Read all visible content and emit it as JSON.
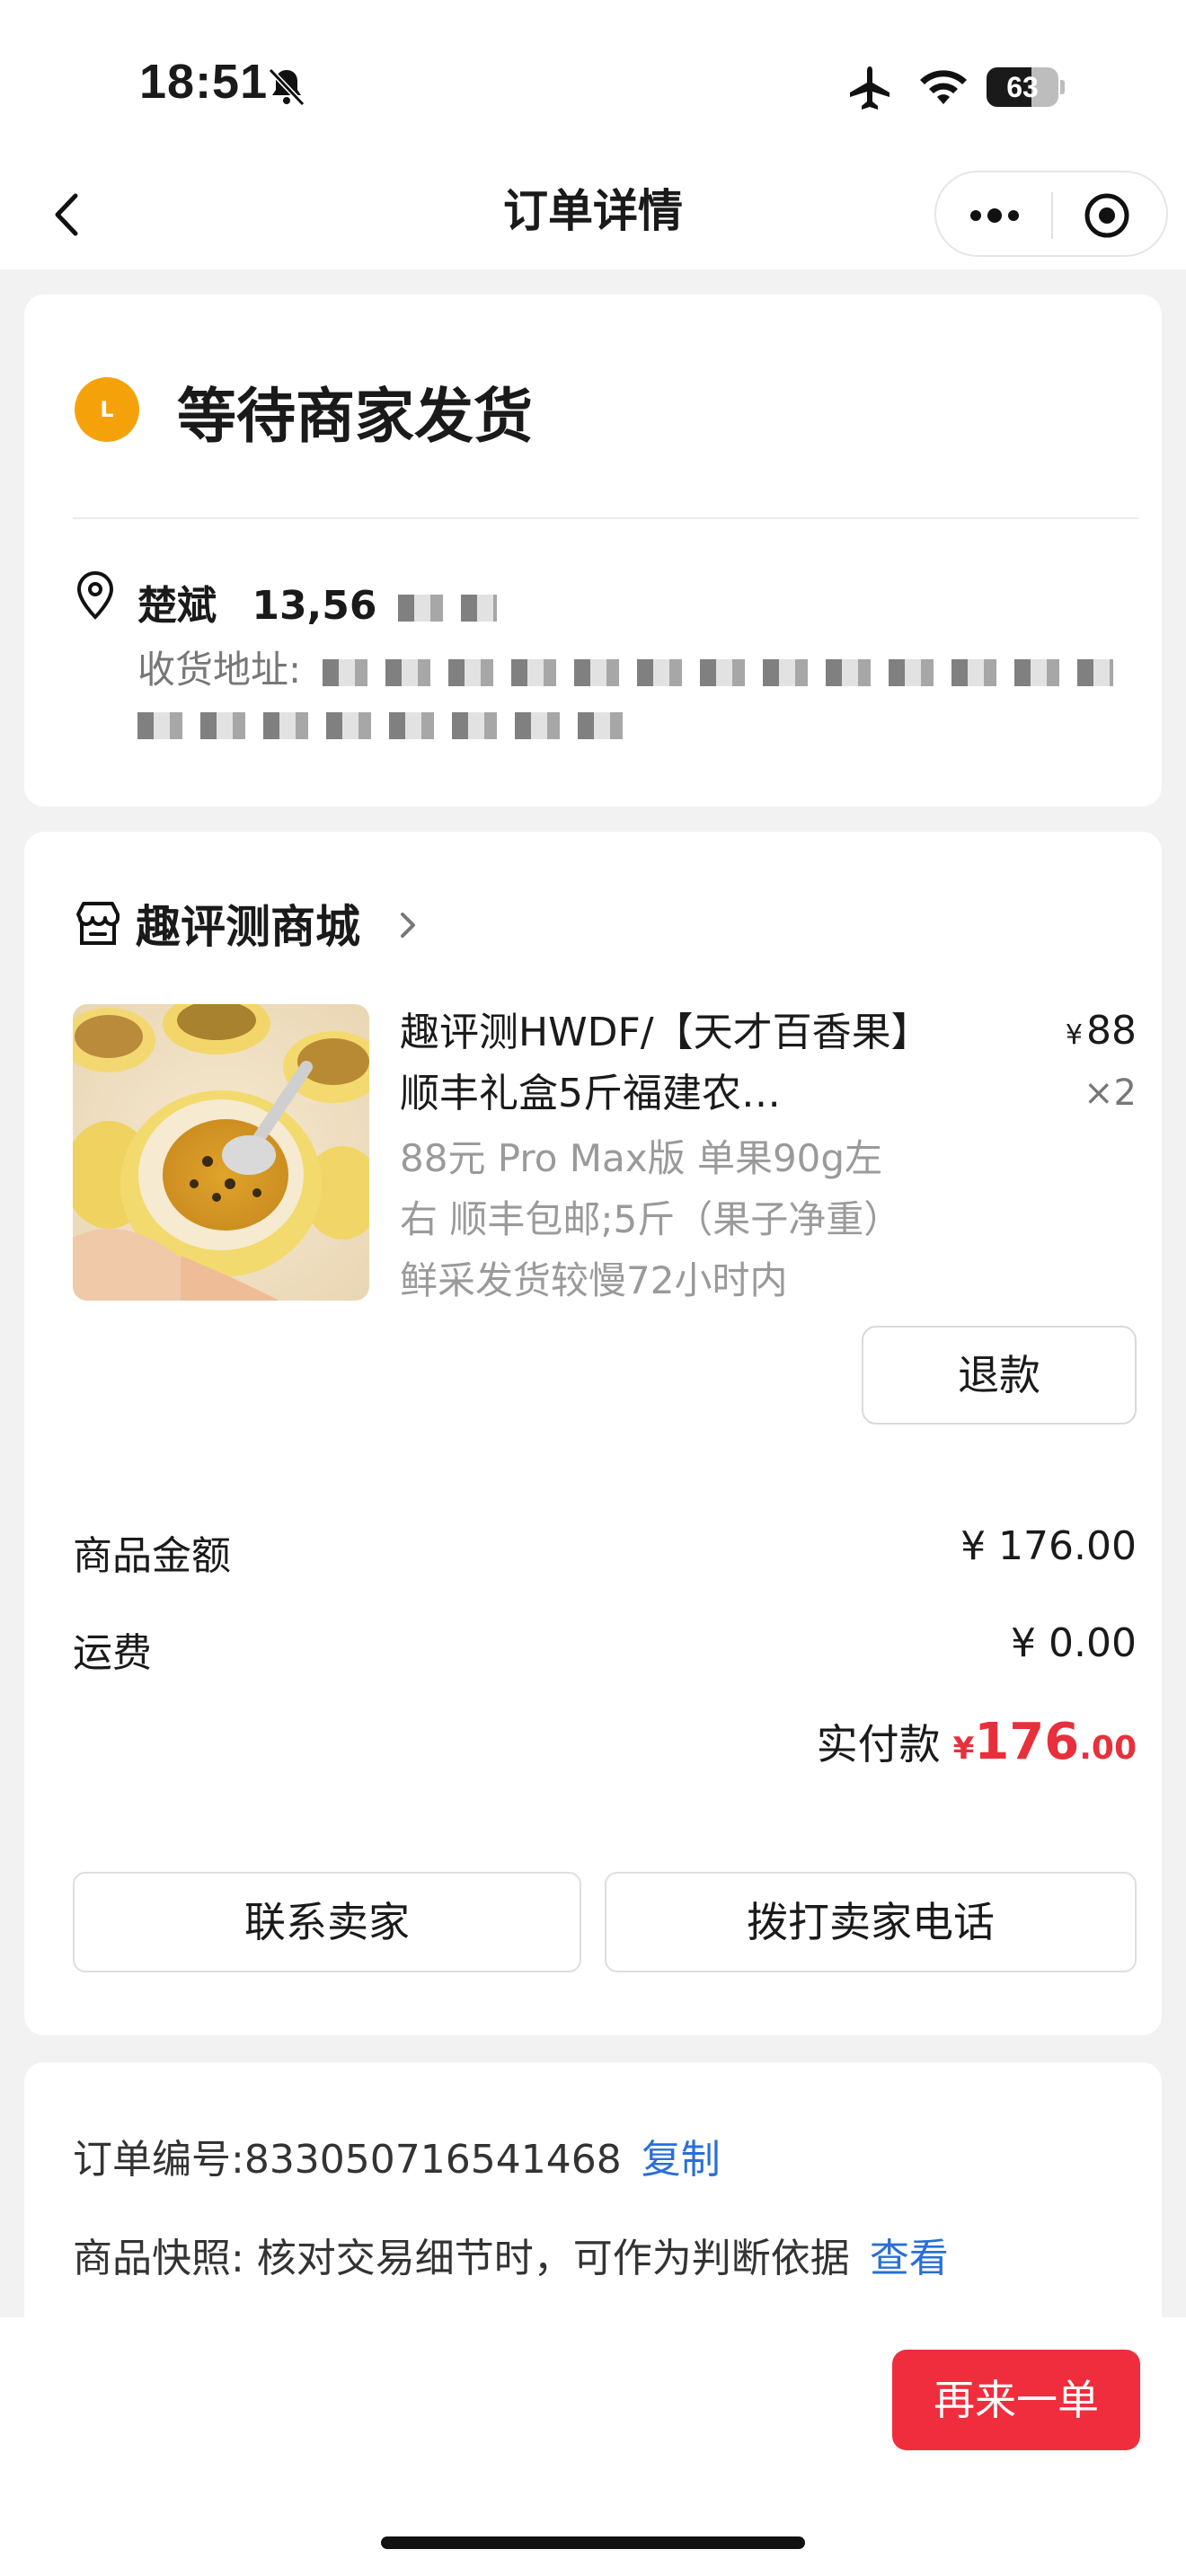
{
  "status_bar": {
    "time": "18:51",
    "battery": "63",
    "battery_level": 0.63
  },
  "nav": {
    "title": "订单详情"
  },
  "order_status": {
    "badge_letter": "L",
    "title": "等待商家发货",
    "recipient_name": "楚斌",
    "recipient_phone": "13,56",
    "address_label": "收货地址:"
  },
  "shop": {
    "name": "趣评测商城"
  },
  "product": {
    "title": "趣评测HWDF/【天才百香果】顺丰礼盒5斤福建农…",
    "spec_line_1": "88元 Pro Max版 单果90g左",
    "spec_line_2": "右 顺丰包邮;5斤（果子净重）",
    "spec_line_3": "鲜采发货较慢72小时内",
    "price_symbol": "¥",
    "price": "88",
    "quantity": "×2",
    "refund_label": "退款"
  },
  "summary": {
    "goods_label": "商品金额",
    "goods_value": "¥ 176.00",
    "shipping_label": "运费",
    "shipping_value": "¥ 0.00",
    "paid_label": "实付款",
    "paid_symbol": "¥",
    "paid_integer": "176",
    "paid_decimal": ".00"
  },
  "actions": {
    "contact_seller": "联系卖家",
    "call_seller": "拨打卖家电话"
  },
  "order_info": {
    "order_number": "订单编号:833050716541468",
    "copy_label": "复制",
    "snapshot_text": "商品快照: 核对交易细节时，可作为判断依据",
    "view_label": "查看"
  },
  "bottom": {
    "reorder_label": "再来一单"
  },
  "colors": {
    "accent_red": "#ef2d3d",
    "price_red": "#e8303c",
    "status_orange": "#f5a20a",
    "link_blue": "#2a6fd6"
  }
}
